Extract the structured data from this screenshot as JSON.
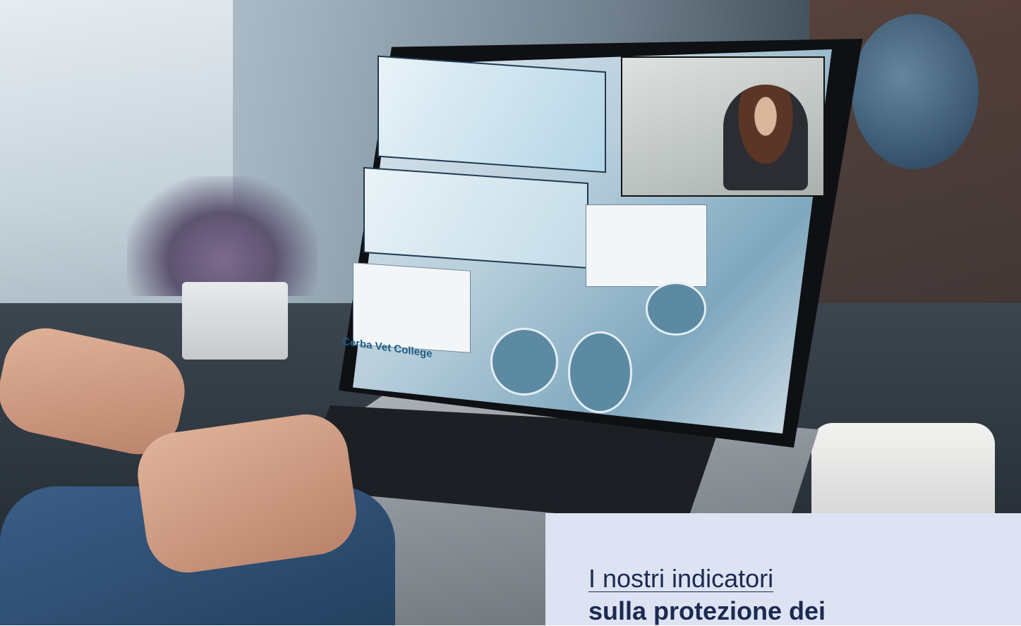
{
  "caption": {
    "line1": "I nostri indicatori",
    "line2": "sulla protezione dei"
  },
  "screen": {
    "logo_text": "Cerba Vet College"
  },
  "colors": {
    "caption_background": "#dde3f2",
    "caption_text": "#1c2a52"
  }
}
